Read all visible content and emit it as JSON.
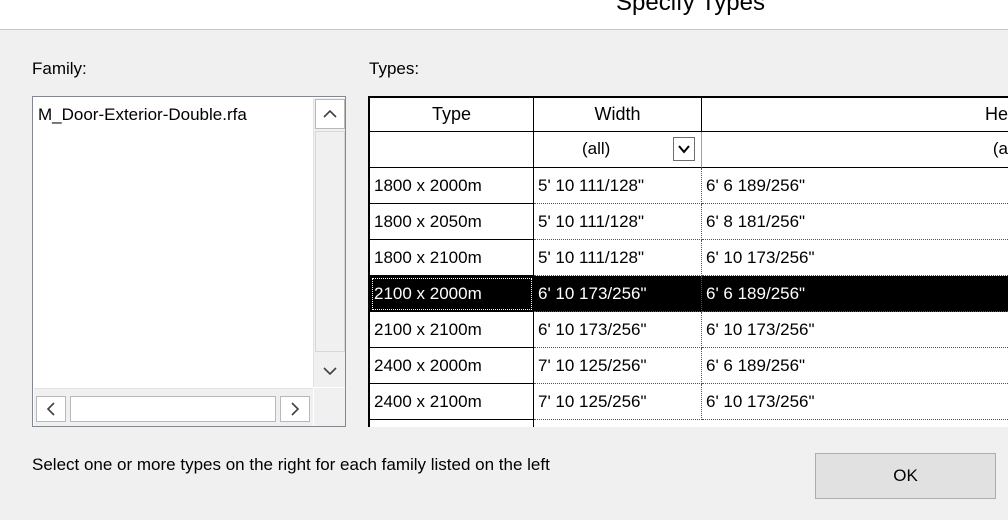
{
  "dialog": {
    "title": "Specify Types"
  },
  "family_panel": {
    "label": "Family:",
    "items": [
      "M_Door-Exterior-Double.rfa"
    ],
    "scroll_up": "^",
    "scroll_down": "v",
    "scroll_left": "<",
    "scroll_right": ">"
  },
  "types_panel": {
    "label": "Types:",
    "columns": [
      "Type",
      "Width",
      "He"
    ],
    "filters": {
      "type": "",
      "width": "(all)",
      "height": "(a"
    },
    "rows": [
      {
        "type": "1800 x 2000m",
        "width": "5'  10 111/128\"",
        "height": "6'  6 189/256\"",
        "selected": false
      },
      {
        "type": "1800 x 2050m",
        "width": "5'  10 111/128\"",
        "height": "6'  8 181/256\"",
        "selected": false
      },
      {
        "type": "1800 x 2100m",
        "width": "5'  10 111/128\"",
        "height": "6'  10 173/256\"",
        "selected": false
      },
      {
        "type": "2100 x 2000m",
        "width": "6'  10 173/256\"",
        "height": "6'  6 189/256\"",
        "selected": true
      },
      {
        "type": "2100 x 2100m",
        "width": "6'  10 173/256\"",
        "height": "6'  10 173/256\"",
        "selected": false
      },
      {
        "type": "2400 x 2000m",
        "width": "7'  10 125/256\"",
        "height": "6'  6 189/256\"",
        "selected": false
      },
      {
        "type": "2400 x 2100m",
        "width": "7'  10 125/256\"",
        "height": "6'  10 173/256\"",
        "selected": false
      }
    ]
  },
  "footer": {
    "instruction": "Select one or more types on the right for each family listed on the left",
    "ok_label": "OK"
  }
}
